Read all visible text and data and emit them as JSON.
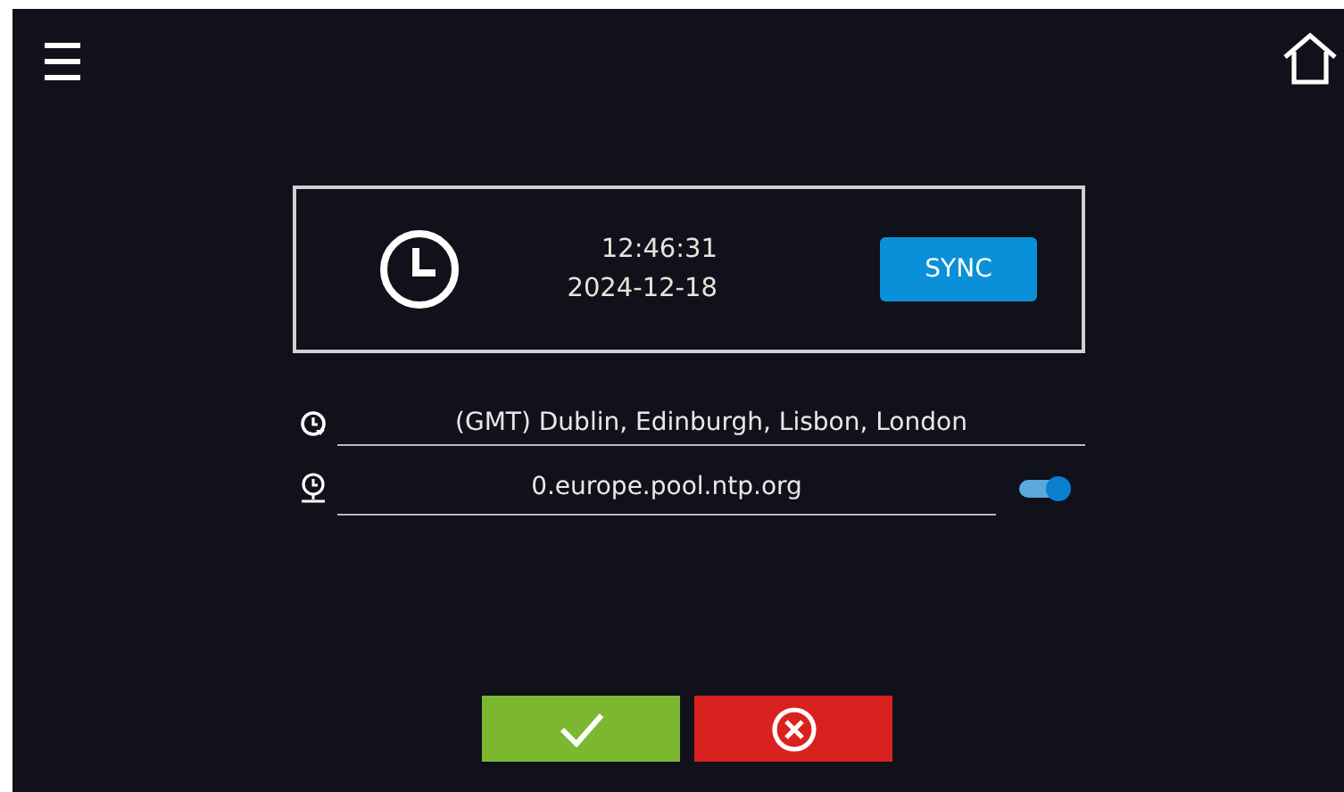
{
  "clock_card": {
    "time": "12:46:31",
    "date": "2024-12-18",
    "sync_button": "SYNC"
  },
  "timezone": {
    "value": "(GMT) Dublin, Edinburgh, Lisbon, London"
  },
  "ntp": {
    "server": "0.europe.pool.ntp.org",
    "enabled": true
  },
  "actions": [
    {
      "kind": "confirm"
    },
    {
      "kind": "cancel"
    }
  ]
}
